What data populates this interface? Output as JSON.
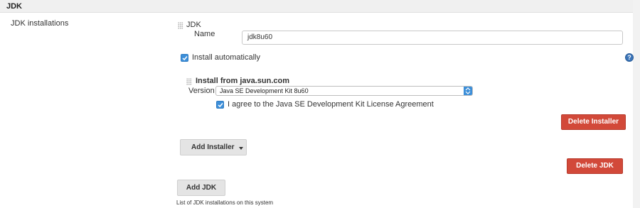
{
  "section": {
    "title": "JDK"
  },
  "field": {
    "label": "JDK installations"
  },
  "jdk": {
    "block_title": "JDK",
    "name_label": "Name",
    "name_value": "jdk8u60",
    "install_auto_label": "Install automatically",
    "install_auto_checked": true,
    "help_symbol": "?"
  },
  "installer": {
    "title": "Install from java.sun.com",
    "version_label": "Version",
    "version_value": "Java SE Development Kit 8u60",
    "license_label": "I agree to the Java SE Development Kit License Agreement",
    "license_checked": true,
    "delete_label": "Delete Installer"
  },
  "buttons": {
    "add_installer": "Add Installer",
    "delete_jdk": "Delete JDK",
    "add_jdk": "Add JDK"
  },
  "footer": {
    "description": "List of JDK installations on this system"
  },
  "colors": {
    "accent": "#3d8fd9",
    "danger": "#d24939",
    "header_bg": "#f0f0f0"
  },
  "icons": {
    "drag_handle": "drag-handle-icon",
    "checkbox": "checkmark-icon",
    "help": "help-icon",
    "select": "select-arrows-icon",
    "dropdown": "caret-down-icon"
  }
}
